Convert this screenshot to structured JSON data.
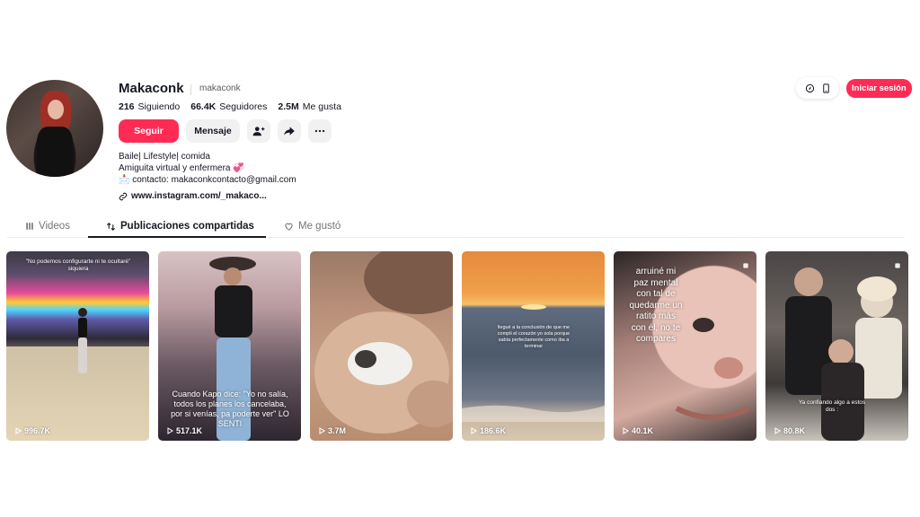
{
  "profile": {
    "username": "Makaconk",
    "handle": "makaconk",
    "following_count": "216",
    "following_label": "Siguiendo",
    "followers_count": "66.4K",
    "followers_label": "Seguidores",
    "likes_count": "2.5M",
    "likes_label": "Me gusta",
    "follow_label": "Seguir",
    "message_label": "Mensaje",
    "bio_lines": [
      "Baile| Lifestyle| comida",
      "Amiguita virtual y enfermera 💞",
      "📩 contacto: makaconkcontacto@gmail.com"
    ],
    "link": "www.instagram.com/_makaco..."
  },
  "header": {
    "login_label": "Iniciar sesión"
  },
  "tabs": [
    {
      "label": "Videos",
      "icon": "grid-icon",
      "active": false
    },
    {
      "label": "Publicaciones compartidas",
      "icon": "repost-icon",
      "active": true
    },
    {
      "label": "Me gustó",
      "icon": "heart-outline-icon",
      "active": false
    }
  ],
  "videos": [
    {
      "views": "996.7K",
      "caption": "\"No podemos configurarte ni te ocultaré\" siquiera"
    },
    {
      "views": "517.1K",
      "caption": "Cuando Kapo dice: \"Yo no salía, todos los planes los cancelaba, por si venías, pa poderte ver\" LO SENTI"
    },
    {
      "views": "3.7M",
      "caption": ""
    },
    {
      "views": "186.6K",
      "caption": "llegué a la conclusión de que me compli el corazón yo sola porque sabía perfectamente como iba a terminar"
    },
    {
      "views": "40.1K",
      "caption": "arruiné mi paz mental con tal de quedarme un ratito más con él, no te compares"
    },
    {
      "views": "80.8K",
      "caption": "Ya confiando algo a estos dos :"
    }
  ],
  "colors": {
    "accent": "#fe2c55",
    "text": "#161823",
    "muted": "#757575"
  }
}
